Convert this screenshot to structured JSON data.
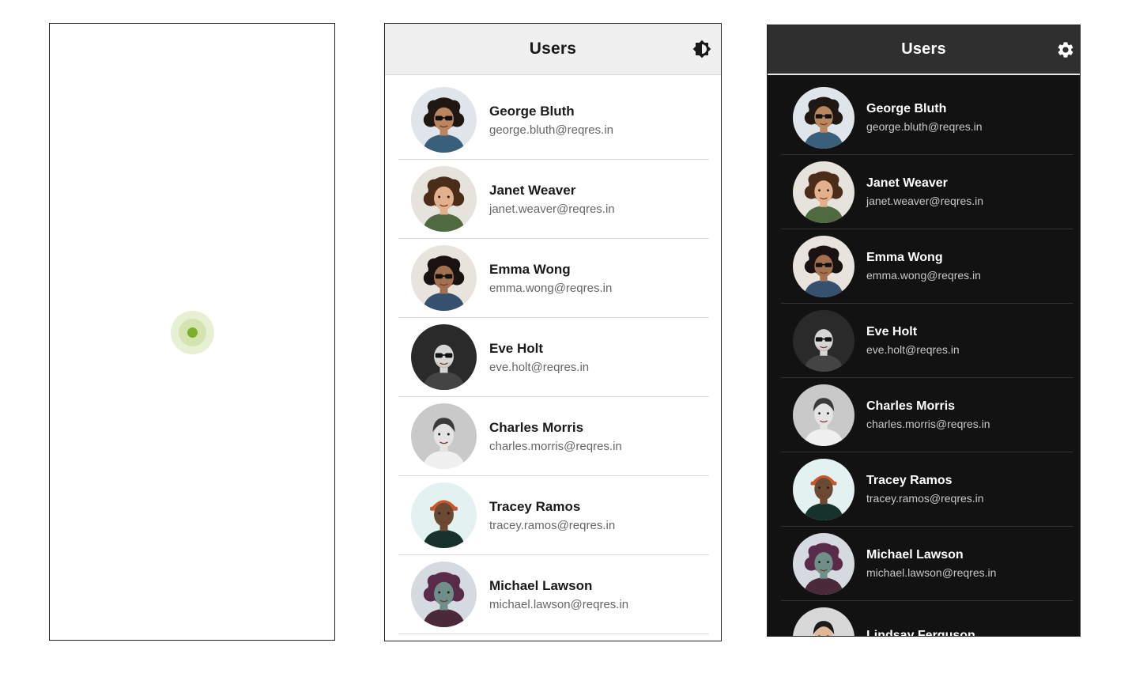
{
  "loading_screen": {
    "spinner_icon": "loading-spinner-icon",
    "accent_color": "#7fae2a"
  },
  "light_screen": {
    "header": {
      "title": "Users",
      "theme_icon": "brightness-icon"
    },
    "users": [
      {
        "name": "George Bluth",
        "email": "george.bluth@reqres.in"
      },
      {
        "name": "Janet Weaver",
        "email": "janet.weaver@reqres.in"
      },
      {
        "name": "Emma Wong",
        "email": "emma.wong@reqres.in"
      },
      {
        "name": "Eve Holt",
        "email": "eve.holt@reqres.in"
      },
      {
        "name": "Charles Morris",
        "email": "charles.morris@reqres.in"
      },
      {
        "name": "Tracey Ramos",
        "email": "tracey.ramos@reqres.in"
      },
      {
        "name": "Michael Lawson",
        "email": "michael.lawson@reqres.in"
      }
    ]
  },
  "dark_screen": {
    "header": {
      "title": "Users",
      "theme_icon": "gear-icon"
    },
    "users": [
      {
        "name": "George Bluth",
        "email": "george.bluth@reqres.in"
      },
      {
        "name": "Janet Weaver",
        "email": "janet.weaver@reqres.in"
      },
      {
        "name": "Emma Wong",
        "email": "emma.wong@reqres.in"
      },
      {
        "name": "Eve Holt",
        "email": "eve.holt@reqres.in"
      },
      {
        "name": "Charles Morris",
        "email": "charles.morris@reqres.in"
      },
      {
        "name": "Tracey Ramos",
        "email": "tracey.ramos@reqres.in"
      },
      {
        "name": "Michael Lawson",
        "email": "michael.lawson@reqres.in"
      },
      {
        "name": "Lindsay Ferguson",
        "email": ""
      }
    ]
  }
}
